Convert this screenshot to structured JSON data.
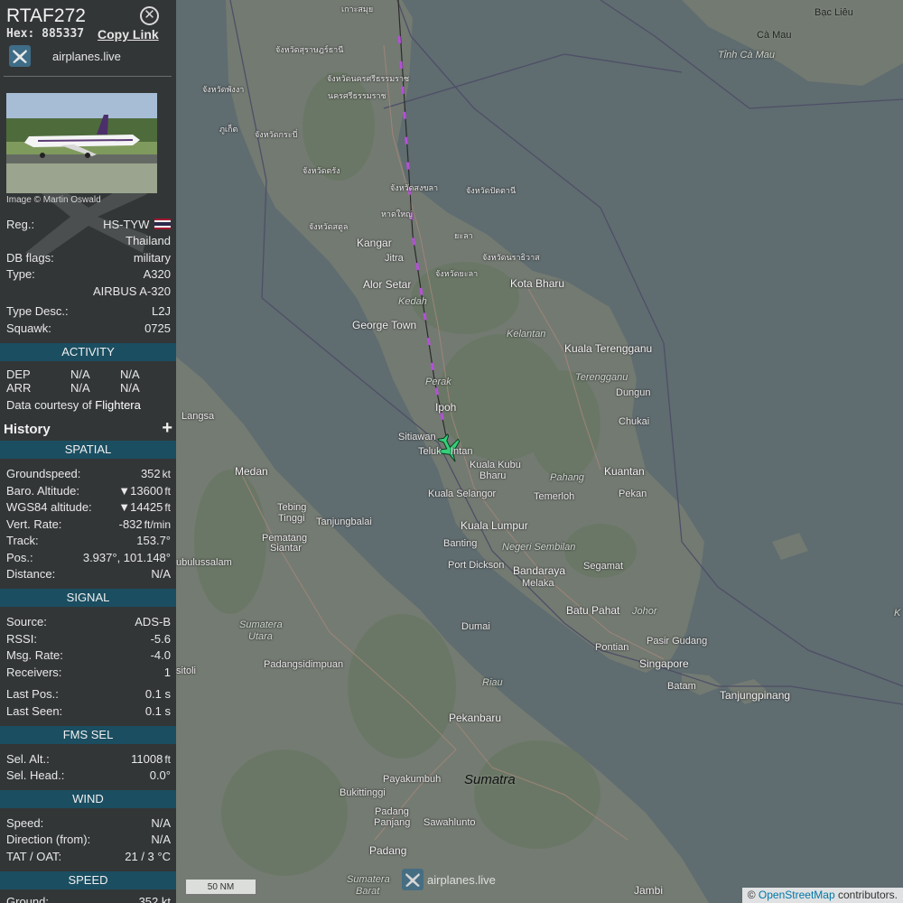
{
  "aircraft": {
    "callsign": "RTAF272",
    "hex_label": "Hex:",
    "hex": "885337",
    "copy_link": "Copy Link",
    "brand": "airplanes.live",
    "photo_credit": "Image © Martin Oswald"
  },
  "details": {
    "reg_label": "Reg.:",
    "reg": "HS-TYW",
    "country": "Thailand",
    "db_flags_label": "DB flags:",
    "db_flags": "military",
    "type_label": "Type:",
    "type": "A320",
    "type_name": "AIRBUS A-320",
    "type_desc_label": "Type Desc.:",
    "type_desc": "L2J",
    "squawk_label": "Squawk:",
    "squawk": "0725"
  },
  "activity": {
    "title": "ACTIVITY",
    "dep_label": "DEP",
    "dep_1": "N/A",
    "dep_2": "N/A",
    "arr_label": "ARR",
    "arr_1": "N/A",
    "arr_2": "N/A",
    "courtesy_prefix": "Data courtesy of",
    "courtesy_source": "Flightera"
  },
  "history": {
    "label": "History",
    "toggle": "+"
  },
  "spatial": {
    "title": "SPATIAL",
    "groundspeed_label": "Groundspeed:",
    "groundspeed": "352",
    "groundspeed_unit": "kt",
    "baro_label": "Baro. Altitude:",
    "baro": "▼13600",
    "baro_unit": "ft",
    "wgs_label": "WGS84 altitude:",
    "wgs": "▼14425",
    "wgs_unit": "ft",
    "vrate_label": "Vert. Rate:",
    "vrate": "-832",
    "vrate_unit": "ft/min",
    "track_label": "Track:",
    "track": "153.7°",
    "pos_label": "Pos.:",
    "pos": "3.937°, 101.148°",
    "distance_label": "Distance:",
    "distance": "N/A"
  },
  "signal": {
    "title": "SIGNAL",
    "source_label": "Source:",
    "source": "ADS-B",
    "rssi_label": "RSSI:",
    "rssi": "-5.6",
    "msg_label": "Msg. Rate:",
    "msg": "-4.0",
    "receivers_label": "Receivers:",
    "receivers": "1",
    "last_pos_label": "Last Pos.:",
    "last_pos": "0.1 s",
    "last_seen_label": "Last Seen:",
    "last_seen": "0.1 s"
  },
  "fms": {
    "title": "FMS SEL",
    "sel_alt_label": "Sel. Alt.:",
    "sel_alt": "11008",
    "sel_alt_unit": "ft",
    "sel_head_label": "Sel. Head.:",
    "sel_head": "0.0°"
  },
  "wind": {
    "title": "WIND",
    "speed_label": "Speed:",
    "speed": "N/A",
    "dir_label": "Direction (from):",
    "dir": "N/A",
    "tat_label": "TAT / OAT:",
    "tat": "21 / 3 °C"
  },
  "speed": {
    "title": "SPEED",
    "ground_label": "Ground:",
    "ground": "352 kt"
  },
  "map": {
    "scale": "50 NM",
    "brand": "airplanes.live",
    "attribution_prefix": "©",
    "attribution_link": "OpenStreetMap",
    "attribution_suffix": "contributors.",
    "labels": {
      "bac_lieu": "Bạc Liêu",
      "ca_mau": "Cà Mau",
      "tinh_ca_mau": "Tỉnh Cà Mau",
      "kangar": "Kangar",
      "jitra": "Jitra",
      "alor_setar": "Alor Setar",
      "kedah": "Kedah",
      "kota_bharu": "Kota Bharu",
      "kelantan": "Kelantan",
      "george_town": "George Town",
      "kuala_terengganu": "Kuala Terengganu",
      "terengganu": "Terengganu",
      "dungun": "Dungun",
      "perak": "Perak",
      "ipoh": "Ipoh",
      "langsa": "Langsa",
      "chukai": "Chukai",
      "sitiawan": "Sitiawan",
      "teluk": "Teluk",
      "intan": "Intan",
      "kuala_kubu": "Kuala Kubu",
      "bharu": "Bharu",
      "medan": "Medan",
      "pahang": "Pahang",
      "kuantan": "Kuantan",
      "kuala_selangor": "Kuala Selangor",
      "temerloh": "Temerloh",
      "pekan": "Pekan",
      "tebing": "Tebing",
      "tinggi": "Tinggi",
      "tanjungbalai": "Tanjungbalai",
      "kuala_lumpur": "Kuala Lumpur",
      "banting": "Banting",
      "negeri_sembilan": "Negeri Sembilan",
      "pematang": "Pematang",
      "siantar": "Siantar",
      "port_dickson": "Port Dickson",
      "bandaraya": "Bandaraya",
      "melaka": "Melaka",
      "segamat": "Segamat",
      "ubulussalam": "ubulussalam",
      "dumai": "Dumai",
      "batu_pahat": "Batu Pahat",
      "johor": "Johor",
      "sumatera_utara_1": "Sumatera",
      "sumatera_utara_2": "Utara",
      "pontian": "Pontian",
      "pasir_gudang": "Pasir Gudang",
      "singapore": "Singapore",
      "sitoli": "sitoli",
      "padangsidimpuan": "Padangsidimpuan",
      "riau": "Riau",
      "batam": "Batam",
      "tanjungpinang": "Tanjungpinang",
      "pekanbaru": "Pekanbaru",
      "sumatra": "Sumatra",
      "payakumbuh": "Payakumbuh",
      "bukittinggi": "Bukittinggi",
      "padang_panjang_1": "Padang",
      "padang_panjang_2": "Panjang",
      "sawahlunto": "Sawahlunto",
      "padang": "Padang",
      "sumatera_barat_1": "Sumatera",
      "sumatera_barat_2": "Barat",
      "jambi": "Jambi",
      "k": "K",
      "th_surat": "จังหวัดสุราษฎร์ธานี",
      "th_nakhon": "จังหวัดนครศรีธรรมราช",
      "th_nakhon_city": "นครศรีธรรมราช",
      "th_phangnga": "จังหวัดพังงา",
      "th_phuket": "ภูเก็ต",
      "th_krabi": "จังหวัดกระบี่",
      "th_trang": "จังหวัดตรัง",
      "th_songkhla": "จังหวัดสงขลา",
      "th_pattani": "จังหวัดปัตตานี",
      "th_hatyai": "หาดใหญ่",
      "th_satun": "จังหวัดสตูล",
      "th_yala": "ยะลา",
      "th_narathiwat": "จังหวัดนราธิวาส",
      "th_yala_prov": "จังหวัดยะลา",
      "th_top": "เกาะสมุย"
    }
  }
}
